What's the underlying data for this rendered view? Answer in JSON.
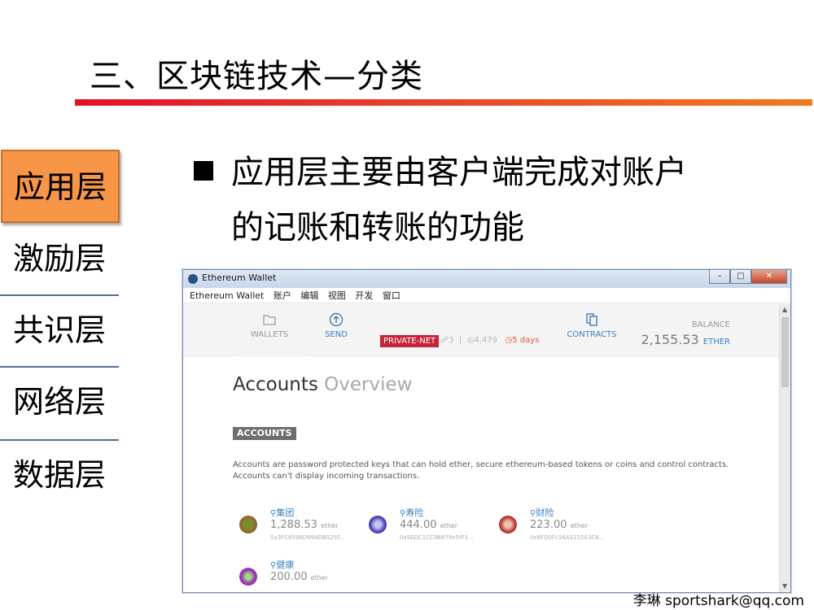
{
  "slide": {
    "title": "三、区块链技术—分类",
    "bullet_line1": "应用层主要由客户端完成对账户",
    "bullet_line2": "的记账和转账的功能",
    "footer": "李琳 sportshark@qq.com"
  },
  "layers": [
    "应用层",
    "激励层",
    "共识层",
    "网络层",
    "数据层"
  ],
  "active_layer": "应用层",
  "window": {
    "title": "Ethereum Wallet",
    "menu": [
      "Ethereum Wallet",
      "账户",
      "编辑",
      "视图",
      "开发",
      "窗口"
    ],
    "nav": {
      "wallets": "WALLETS",
      "send": "SEND",
      "contracts": "CONTRACTS",
      "private_net": "PRIVATE-NET",
      "peers": "3",
      "block": "4,479",
      "age": "5 days",
      "balance_label": "BALANCE",
      "balance_value": "2,155.53",
      "balance_unit": "ETHER"
    },
    "heading_main": "Accounts",
    "heading_sub": "Overview",
    "section_tag": "ACCOUNTS",
    "description": "Accounts are password protected keys that can hold ether, secure ethereum-based tokens or coins and control contracts. Accounts can't display incoming transactions.",
    "accounts": [
      {
        "name": "集团",
        "amount": "1,288.53",
        "unit": "ether",
        "address": "0x3FC6596D994DB525F..."
      },
      {
        "name": "寿险",
        "amount": "444.00",
        "unit": "ether",
        "address": "0x5EDC1CC96879e5fF3..."
      },
      {
        "name": "财险",
        "amount": "223.00",
        "unit": "ether",
        "address": "0x8FD0Fc16A3155A3C6..."
      },
      {
        "name": "健康",
        "amount": "200.00",
        "unit": "ether",
        "address": ""
      }
    ]
  },
  "colors": {
    "accent_red": "#e3102b",
    "active_layer_bg": "#f79646",
    "link_blue": "#3a7fbf",
    "private_net_bg": "#c62436"
  }
}
